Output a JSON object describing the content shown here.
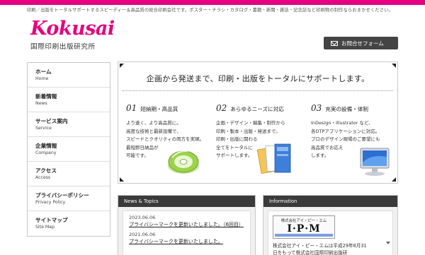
{
  "header": {
    "tagline": "印刷／出版をトータルサポートするスピーディー＆高品質の総合印刷会社です。ポスター・チラシ・カタログ・書籍・新聞・雑誌・記念誌など印刷物の制作ならおまかせください。",
    "logo_word": "Kokusai",
    "logo_subtitle": "国際印刷出版研究所",
    "contact_label": "お問合せフォーム"
  },
  "sidebar": {
    "items": [
      {
        "ja": "ホーム",
        "en": "Home"
      },
      {
        "ja": "新着情報",
        "en": "News"
      },
      {
        "ja": "サービス案内",
        "en": "Service"
      },
      {
        "ja": "企業情報",
        "en": "Company"
      },
      {
        "ja": "アクセス",
        "en": "Access"
      },
      {
        "ja": "プライバシーポリシー",
        "en": "Privacy Policy"
      },
      {
        "ja": "サイトマップ",
        "en": "Site Map"
      }
    ]
  },
  "hero": {
    "title": "企画から発送まで、印刷・出版をトータルにサポートします。",
    "features": [
      {
        "num": "01",
        "title": "短納期・高品質",
        "desc": "より速く、より高品質に。\n高度な技術と最新設備で、\nスピードとクオリティの両方を実現。\n最短即日納品が\n可能です。",
        "icon": "cd-disc-icon"
      },
      {
        "num": "02",
        "title": "あらゆるニーズに対応",
        "desc": "企画・デザイン・編集・制作から\n印刷・製本・出版・発送まで。\n印刷・出版に関わる\n全てをトータルに\nサポートします。",
        "icon": "books-icon"
      },
      {
        "num": "03",
        "title": "充実の設備・体制",
        "desc": "InDesign・Illustrator など、\n各DTPアプリケーションに対応。\nプロのデザイン現場のご要望にも\n高品質でお応え\nします。",
        "icon": "monitor-icon"
      }
    ]
  },
  "news": {
    "heading": "News & Topics",
    "items": [
      {
        "date": "2023.06.06",
        "text": "プライバシーマークを更新いたしました。（6回目）"
      },
      {
        "date": "2021.06.06",
        "text": "プライバシーマークを更新いたしました。"
      }
    ]
  },
  "info": {
    "heading": "Information",
    "banner_subtitle": "株式会社アイ・ピー・エム",
    "banner_logo": "I·P·M",
    "text_lines": [
      "株式会社アイ・ピー・エムは平成29年8月31",
      "日をもって株式会社国際印刷出版研"
    ]
  },
  "colors": {
    "brand_pink": "#e4007f",
    "dark_bar": "#3a3a3a"
  }
}
